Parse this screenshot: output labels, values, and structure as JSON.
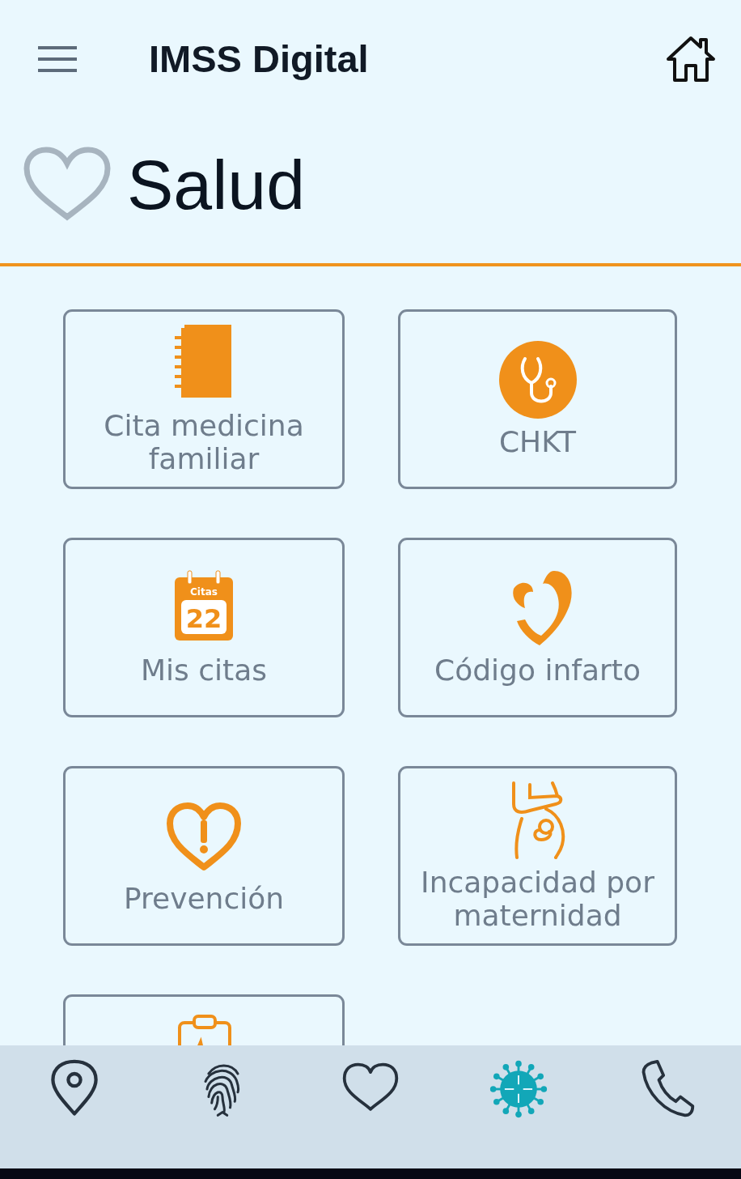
{
  "app_bar": {
    "title": "IMSS Digital"
  },
  "section": {
    "title": "Salud"
  },
  "cards": [
    {
      "kind": "notebook",
      "label": "Cita medicina familiar"
    },
    {
      "kind": "stethoscope",
      "label": "CHKT"
    },
    {
      "kind": "calendar",
      "label": "Mis citas",
      "icon_caption": "Citas",
      "icon_number": "22"
    },
    {
      "kind": "heart-hands",
      "label": "Código infarto"
    },
    {
      "kind": "heart-alert",
      "label": "Prevención"
    },
    {
      "kind": "pregnancy",
      "label": "Incapacidad por maternidad"
    },
    {
      "kind": "clipboard"
    }
  ],
  "bottom_nav": [
    {
      "kind": "pin"
    },
    {
      "kind": "fingerprint"
    },
    {
      "kind": "heart"
    },
    {
      "kind": "virus"
    },
    {
      "kind": "phone"
    }
  ]
}
